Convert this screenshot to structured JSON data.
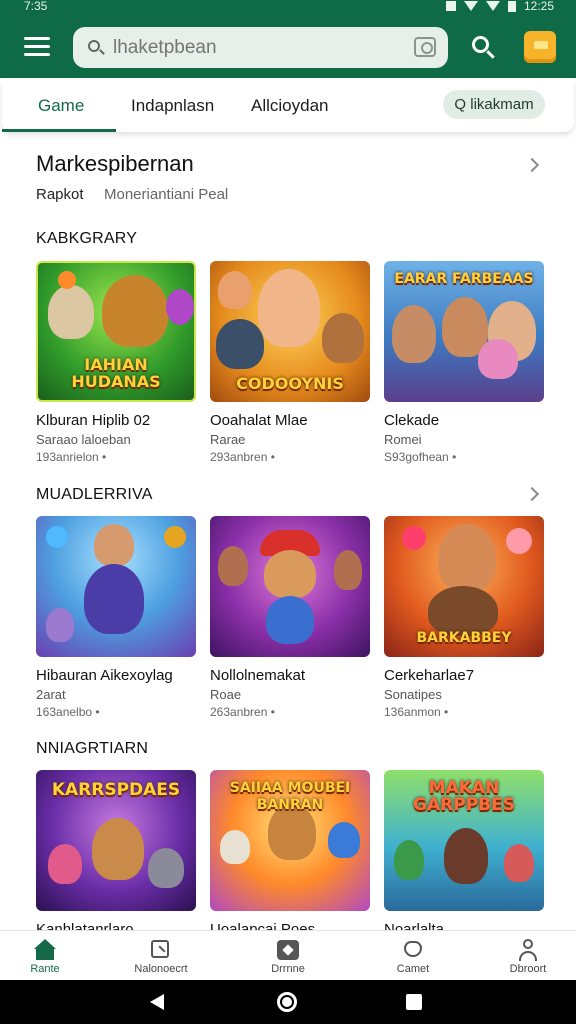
{
  "status_bar": {
    "time": "7:35",
    "clock_right": "12:25"
  },
  "search": {
    "placeholder": "lhaketpbean"
  },
  "tabs": [
    {
      "label": "Game",
      "active": true
    },
    {
      "label": "Indapnlasn",
      "active": false
    },
    {
      "label": "Allcioydan",
      "active": false
    }
  ],
  "tab_chip": {
    "label": "Q likakmam"
  },
  "market": {
    "title": "Markespibernan",
    "sub_a": "Rapkot",
    "sub_b": "Moneriantiani Peal"
  },
  "sections": [
    {
      "label": "KABKGRARY",
      "cards": [
        {
          "title": "Klburan Hiplib 02",
          "subtitle": "Saraao laloeban",
          "meta": "193anrielon •",
          "logo": "IAHIAN HUDANAS"
        },
        {
          "title": "Ooahalat Mlae",
          "subtitle": "Rarae",
          "meta": "293anbren •",
          "logo": "CODOOYNIS"
        },
        {
          "title": "Clekade",
          "subtitle": "Romei",
          "meta": "S93gofhean •",
          "logo": "EARAR FARBEAAS"
        }
      ]
    },
    {
      "label": "MUADLERRIVA",
      "cards": [
        {
          "title": "Hibauran Aikexoylag",
          "subtitle": "2arat",
          "meta": "163anelbo •",
          "logo": ""
        },
        {
          "title": "Nollolnemakat",
          "subtitle": "Roae",
          "meta": "263anbren •",
          "logo": ""
        },
        {
          "title": "Cerkeharlae7",
          "subtitle": "Sonatipes",
          "meta": "136anmon •",
          "logo": "BARKABBEY"
        }
      ]
    },
    {
      "label": "NNIAGRTIARN",
      "cards": [
        {
          "title": "Kanhlatanrlaro",
          "logo": "KARRSPDAES"
        },
        {
          "title": "Uoalapcai Poes",
          "logo": "SAIIAA MOUBEI BANRAN"
        },
        {
          "title": "Noarlalta",
          "logo": "MAKAN GARPPBES"
        }
      ]
    }
  ],
  "bottom_nav": [
    {
      "label": "Rante",
      "icon": "home-icon",
      "active": true
    },
    {
      "label": "Nalonoecrt",
      "icon": "library-icon",
      "active": false
    },
    {
      "label": "Drrnne",
      "icon": "games-icon",
      "active": false
    },
    {
      "label": "Camet",
      "icon": "heart-icon",
      "active": false
    },
    {
      "label": "Dbroort",
      "icon": "profile-icon",
      "active": false
    }
  ],
  "colors": {
    "brand_green": "#0f6a48",
    "wallet": "#f5b42a"
  }
}
